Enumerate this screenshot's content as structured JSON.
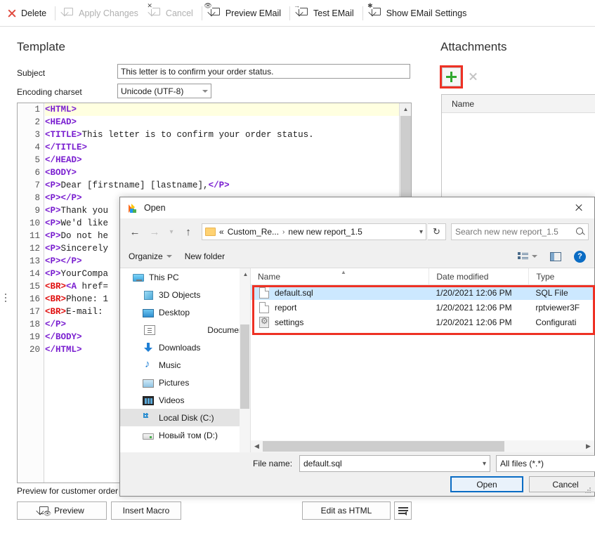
{
  "toolbar": {
    "items": [
      {
        "label": "Delete",
        "icon": "delete-x-icon",
        "disabled": false
      },
      {
        "label": "Apply Changes",
        "icon": "apply-changes-icon",
        "disabled": true
      },
      {
        "label": "Cancel",
        "icon": "cancel-icon",
        "disabled": true
      },
      {
        "label": "Preview EMail",
        "icon": "preview-email-icon",
        "disabled": false
      },
      {
        "label": "Test EMail",
        "icon": "test-email-icon",
        "disabled": false
      },
      {
        "label": "Show EMail Settings",
        "icon": "email-settings-icon",
        "disabled": false
      }
    ]
  },
  "template": {
    "heading": "Template",
    "subject_label": "Subject",
    "subject_value": "This letter is to confirm your order status.",
    "charset_label": "Encoding charset",
    "charset_value": "Unicode (UTF-8)",
    "code_lines": [
      {
        "n": "1",
        "segs": [
          {
            "t": "<HTML>",
            "c": "tg"
          }
        ]
      },
      {
        "n": "2",
        "segs": [
          {
            "t": "<HEAD>",
            "c": "tg"
          }
        ]
      },
      {
        "n": "3",
        "segs": [
          {
            "t": "<TITLE>",
            "c": "tg"
          },
          {
            "t": "This letter is to confirm your order status.",
            "c": ""
          }
        ]
      },
      {
        "n": "4",
        "segs": [
          {
            "t": "</TITLE>",
            "c": "tg"
          }
        ]
      },
      {
        "n": "5",
        "segs": [
          {
            "t": "</HEAD>",
            "c": "tg"
          }
        ]
      },
      {
        "n": "6",
        "segs": [
          {
            "t": "<BODY>",
            "c": "tg"
          }
        ]
      },
      {
        "n": "7",
        "segs": [
          {
            "t": "<P>",
            "c": "tg"
          },
          {
            "t": "Dear [firstname] [lastname],",
            "c": ""
          },
          {
            "t": "</P>",
            "c": "tg"
          }
        ]
      },
      {
        "n": "8",
        "segs": [
          {
            "t": "<P>",
            "c": "tg"
          },
          {
            "t": "</P>",
            "c": "tg"
          }
        ]
      },
      {
        "n": "9",
        "segs": [
          {
            "t": "<P>",
            "c": "tg"
          },
          {
            "t": "Thank you",
            "c": ""
          }
        ]
      },
      {
        "n": "10",
        "segs": [
          {
            "t": "<P>",
            "c": "tg"
          },
          {
            "t": "We'd like",
            "c": ""
          }
        ]
      },
      {
        "n": "11",
        "segs": [
          {
            "t": "<P>",
            "c": "tg"
          },
          {
            "t": "Do not he",
            "c": ""
          }
        ]
      },
      {
        "n": "12",
        "segs": [
          {
            "t": "<P>",
            "c": "tg"
          },
          {
            "t": "Sincerely",
            "c": ""
          }
        ]
      },
      {
        "n": "13",
        "segs": [
          {
            "t": "<P>",
            "c": "tg"
          },
          {
            "t": "</P>",
            "c": "tg"
          }
        ]
      },
      {
        "n": "14",
        "segs": [
          {
            "t": "<P>",
            "c": "tg"
          },
          {
            "t": "YourCompa",
            "c": ""
          }
        ]
      },
      {
        "n": "15",
        "segs": [
          {
            "t": "<BR>",
            "c": "tgr"
          },
          {
            "t": "<A",
            "c": "tg"
          },
          {
            "t": " href=",
            "c": ""
          }
        ]
      },
      {
        "n": "16",
        "segs": [
          {
            "t": "<BR>",
            "c": "tgr"
          },
          {
            "t": "Phone: 1",
            "c": ""
          }
        ]
      },
      {
        "n": "17",
        "segs": [
          {
            "t": "<BR>",
            "c": "tgr"
          },
          {
            "t": "E-mail:",
            "c": ""
          }
        ]
      },
      {
        "n": "18",
        "segs": [
          {
            "t": "</P>",
            "c": "tg"
          }
        ]
      },
      {
        "n": "19",
        "segs": [
          {
            "t": "</BODY>",
            "c": "tg"
          }
        ]
      },
      {
        "n": "20",
        "segs": [
          {
            "t": "</HTML>",
            "c": "tg"
          }
        ]
      }
    ]
  },
  "bottom": {
    "preview_note": "Preview for customer order",
    "preview_label": "Preview",
    "insert_macro_label": "Insert Macro",
    "edit_html_label": "Edit as HTML"
  },
  "attachments": {
    "heading": "Attachments",
    "add_label": "+",
    "column_name": "Name",
    "rows": []
  },
  "dialog": {
    "title": "Open",
    "breadcrumb": {
      "prefix": "«",
      "parent": "Custom_Re...",
      "separator": "›",
      "current": "new new report_1.5"
    },
    "search_placeholder": "Search new new report_1.5",
    "organize_label": "Organize",
    "new_folder_label": "New folder",
    "nav_items": [
      {
        "label": "This PC",
        "icon": "this-pc-icon",
        "indent": false,
        "selected": false,
        "ico": "i-pc"
      },
      {
        "label": "3D Objects",
        "icon": "3d-objects-icon",
        "indent": true,
        "selected": false,
        "ico": "i-3d"
      },
      {
        "label": "Desktop",
        "icon": "desktop-icon",
        "indent": true,
        "selected": false,
        "ico": "i-desk"
      },
      {
        "label": "Documents",
        "icon": "documents-icon",
        "indent": true,
        "selected": false,
        "ico": "i-doc"
      },
      {
        "label": "Downloads",
        "icon": "downloads-icon",
        "indent": true,
        "selected": false,
        "ico": "i-dl"
      },
      {
        "label": "Music",
        "icon": "music-icon",
        "indent": true,
        "selected": false,
        "ico": "i-mus"
      },
      {
        "label": "Pictures",
        "icon": "pictures-icon",
        "indent": true,
        "selected": false,
        "ico": "i-pic"
      },
      {
        "label": "Videos",
        "icon": "videos-icon",
        "indent": true,
        "selected": false,
        "ico": "i-vid"
      },
      {
        "label": "Local Disk (C:)",
        "icon": "local-disk-icon",
        "indent": true,
        "selected": true,
        "ico": "i-hdd-c"
      },
      {
        "label": "Новый том (D:)",
        "icon": "drive-d-icon",
        "indent": true,
        "selected": false,
        "ico": "i-hdd2"
      }
    ],
    "columns": {
      "name": "Name",
      "date": "Date modified",
      "type": "Type"
    },
    "files": [
      {
        "name": "default.sql",
        "date": "1/20/2021 12:06 PM",
        "type": "SQL File",
        "icon": "doc",
        "selected": true
      },
      {
        "name": "report",
        "date": "1/20/2021 12:06 PM",
        "type": "rptviewer3F",
        "icon": "doc",
        "selected": false
      },
      {
        "name": "settings",
        "date": "1/20/2021 12:06 PM",
        "type": "Configurati",
        "icon": "cog",
        "selected": false
      }
    ],
    "filename_label": "File name:",
    "filename_value": "default.sql",
    "filter_value": "All files (*.*)",
    "open_label": "Open",
    "cancel_label": "Cancel"
  },
  "colors": {
    "accent_blue": "#0a6cc4",
    "selection_blue": "#cce8ff",
    "annotation_red": "#ee3124",
    "plus_green": "#2fa82f",
    "delete_red": "#e04a3f",
    "tag_purple": "#7a1fd0",
    "tag_red": "#e01010"
  }
}
